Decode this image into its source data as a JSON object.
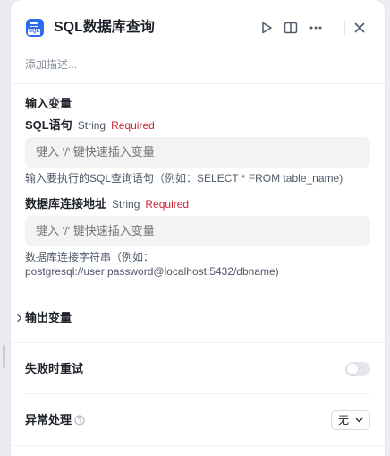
{
  "header": {
    "icon_tag": "SQL",
    "title": "SQL数据库查询",
    "icons": [
      "run-icon",
      "layout-split-icon",
      "more-icon",
      "close-icon"
    ]
  },
  "description_placeholder": "添加描述...",
  "input_variables": {
    "section_title": "输入变量",
    "fields": [
      {
        "name": "SQL语句",
        "type": "String",
        "required": "Required",
        "placeholder": "键入 '/' 键快速插入变量",
        "help": "输入要执行的SQL查询语句（例如：SELECT * FROM table_name)"
      },
      {
        "name": "数据库连接地址",
        "type": "String",
        "required": "Required",
        "placeholder": "键入 '/' 键快速插入变量",
        "help_line1": "数据库连接字符串（例如：",
        "help_line2": "postgresql://user:password@localhost:5432/dbname)"
      }
    ]
  },
  "output_variables": {
    "label": "输出变量",
    "expanded": false
  },
  "retry_on_failure": {
    "label": "失败时重试",
    "enabled": false
  },
  "error_handling": {
    "label": "异常处理",
    "value": "无"
  },
  "colors": {
    "accent": "#2b6bf0",
    "required": "#cb2634",
    "input_bg": "#f2f3f5"
  }
}
